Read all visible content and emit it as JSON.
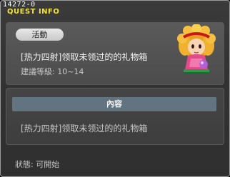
{
  "window": {
    "quest_id": "14272-0",
    "title": "QUEST INFO"
  },
  "summary": {
    "category_tag": "活動",
    "quest_name": "[热力四射]领取未领过的的礼物箱",
    "level_requirement": "建議等級: 10~14",
    "npc_portrait_icon": "npc-girl-portrait"
  },
  "detail": {
    "section_label": "內容",
    "content_text": "[热力四射]领取未领过的的礼物箱"
  },
  "footer": {
    "status_text": "狀態: 可開始"
  },
  "colors": {
    "title": "#f4e23c",
    "section_bar": "#617480"
  }
}
